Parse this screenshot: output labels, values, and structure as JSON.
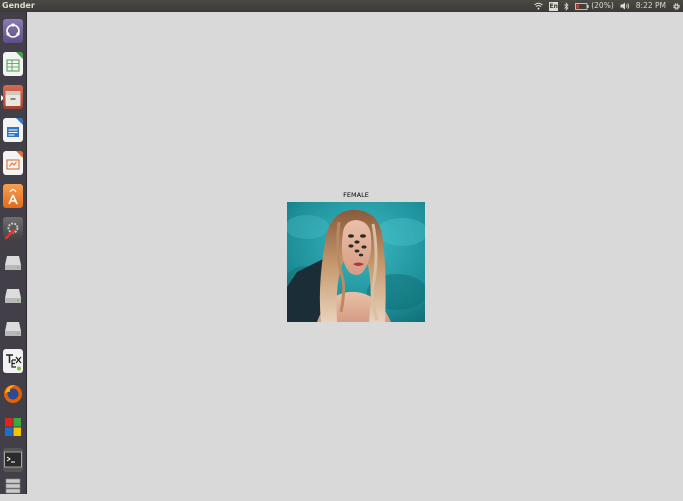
{
  "window": {
    "title": "Gender"
  },
  "top_panel": {
    "wifi_icon": "wifi-icon",
    "keyboard_layout": "En",
    "bluetooth_icon": "bluetooth-icon",
    "battery_percent": "(20%)",
    "volume_icon": "volume-icon",
    "clock": "8:22 PM",
    "settings_icon": "gear-icon"
  },
  "launcher": {
    "items": [
      {
        "name": "dash-home",
        "icon": "ubuntu-logo-icon"
      },
      {
        "name": "libreoffice-calc",
        "icon": "spreadsheet-icon"
      },
      {
        "name": "file-manager",
        "icon": "files-icon"
      },
      {
        "name": "libreoffice-writer",
        "icon": "document-icon"
      },
      {
        "name": "libreoffice-impress",
        "icon": "presentation-icon"
      },
      {
        "name": "ubuntu-software",
        "icon": "software-center-icon"
      },
      {
        "name": "system-settings",
        "icon": "settings-wrench-icon"
      },
      {
        "name": "drive-1",
        "icon": "drive-icon"
      },
      {
        "name": "drive-2",
        "icon": "drive-icon"
      },
      {
        "name": "drive-3",
        "icon": "drive-icon"
      },
      {
        "name": "tex-editor",
        "icon": "tex-icon"
      },
      {
        "name": "firefox",
        "icon": "firefox-icon"
      },
      {
        "name": "wine-apps",
        "icon": "windows-logo-icon"
      },
      {
        "name": "terminal",
        "icon": "terminal-icon"
      },
      {
        "name": "trash",
        "icon": "trash-icon"
      }
    ]
  },
  "content": {
    "image_title": "FEMALE",
    "photo_subject": "portrait-photo"
  },
  "colors": {
    "desktop_background": "#d9d9d9",
    "panel_background": "#3b3a36",
    "launcher_background": "#433f48",
    "photo_background": "#1f8f98",
    "battery_warning": "#e03a2a"
  }
}
